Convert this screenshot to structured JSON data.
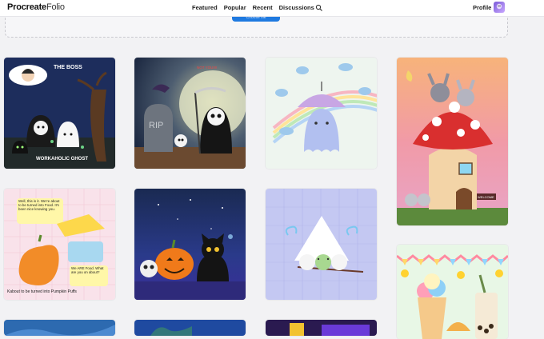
{
  "header": {
    "logo_main": "Procreate",
    "logo_sub": "Folio",
    "nav": [
      "Featured",
      "Popular",
      "Recent",
      "Discussions"
    ],
    "profile_label": "Profile"
  },
  "upload": {
    "button_label": "Choose file"
  },
  "gallery": {
    "card1": {
      "title": "THE BOSS",
      "caption": "WORKAHOLIC GHOST"
    },
    "card2": {
      "label": "RIP",
      "note": "NOT YOU!!!!"
    },
    "card5": {
      "bubble1": "Well, this is it. We're about to be turned into Food. It's been nice knowing you.",
      "bubble2": "We ARE Food. What are you on about?",
      "caption": "Kabout to be turned into Pumpkin Puffs"
    },
    "card7": {
      "sign": "WELCOME"
    }
  }
}
